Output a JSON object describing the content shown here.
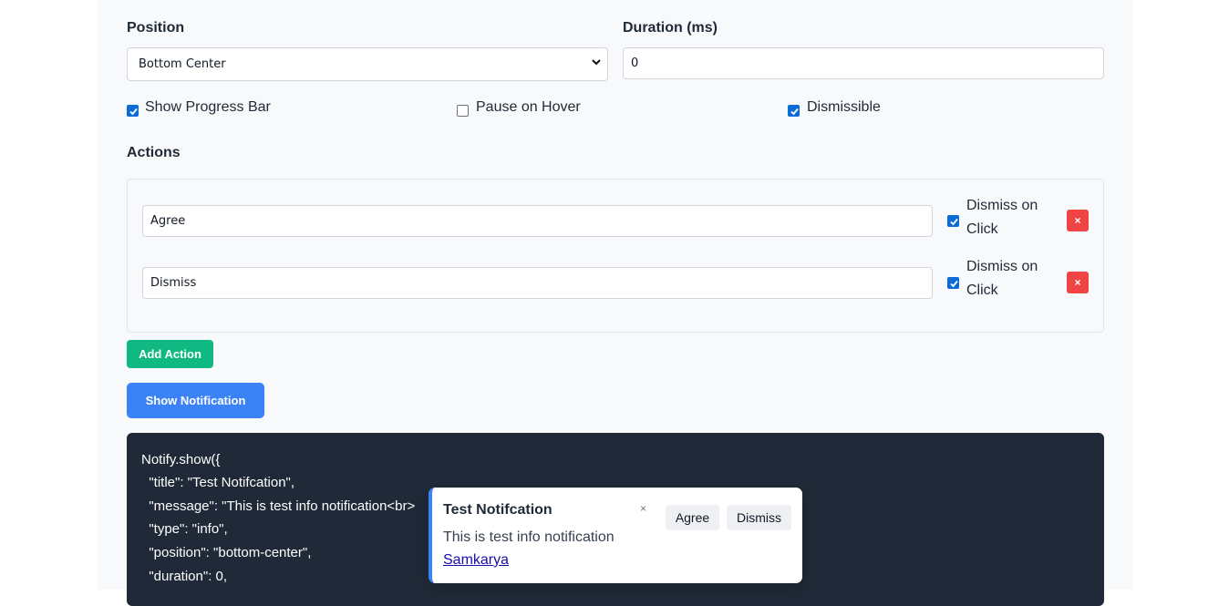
{
  "form": {
    "position_label": "Position",
    "position_value": "Bottom Center",
    "duration_label": "Duration (ms)",
    "duration_value": "0",
    "show_progress_label": "Show Progress Bar",
    "show_progress_checked": true,
    "pause_on_hover_label": "Pause on Hover",
    "pause_on_hover_checked": false,
    "dismissible_label": "Dismissible",
    "dismissible_checked": true
  },
  "actions": {
    "heading": "Actions",
    "items": [
      {
        "value": "Agree",
        "dismiss_label_line1": "Dismiss on",
        "dismiss_label_line2": "Click",
        "dismiss_checked": true,
        "delete_label": "×"
      },
      {
        "value": "Dismiss",
        "dismiss_label_line1": "Dismiss on",
        "dismiss_label_line2": "Click",
        "dismiss_checked": true,
        "delete_label": "×"
      }
    ],
    "add_button": "Add Action"
  },
  "show_button": "Show Notification",
  "code_lines": [
    "Notify.show({",
    "  \"title\": \"Test Notifcation\",",
    "  \"message\": \"This is test info notification<br>",
    "  \"type\": \"info\",",
    "  \"position\": \"bottom-center\",",
    "  \"duration\": 0,"
  ],
  "toast": {
    "title": "Test Notifcation",
    "close": "×",
    "message": "This is test info notification",
    "link": "Samkarya",
    "buttons": [
      "Agree",
      "Dismiss"
    ]
  },
  "colors": {
    "accent_blue": "#3b82f6",
    "add_green": "#10b981",
    "delete_red": "#ef4444",
    "code_bg": "#1f2937",
    "checkbox_blue": "#0b6bd7"
  }
}
